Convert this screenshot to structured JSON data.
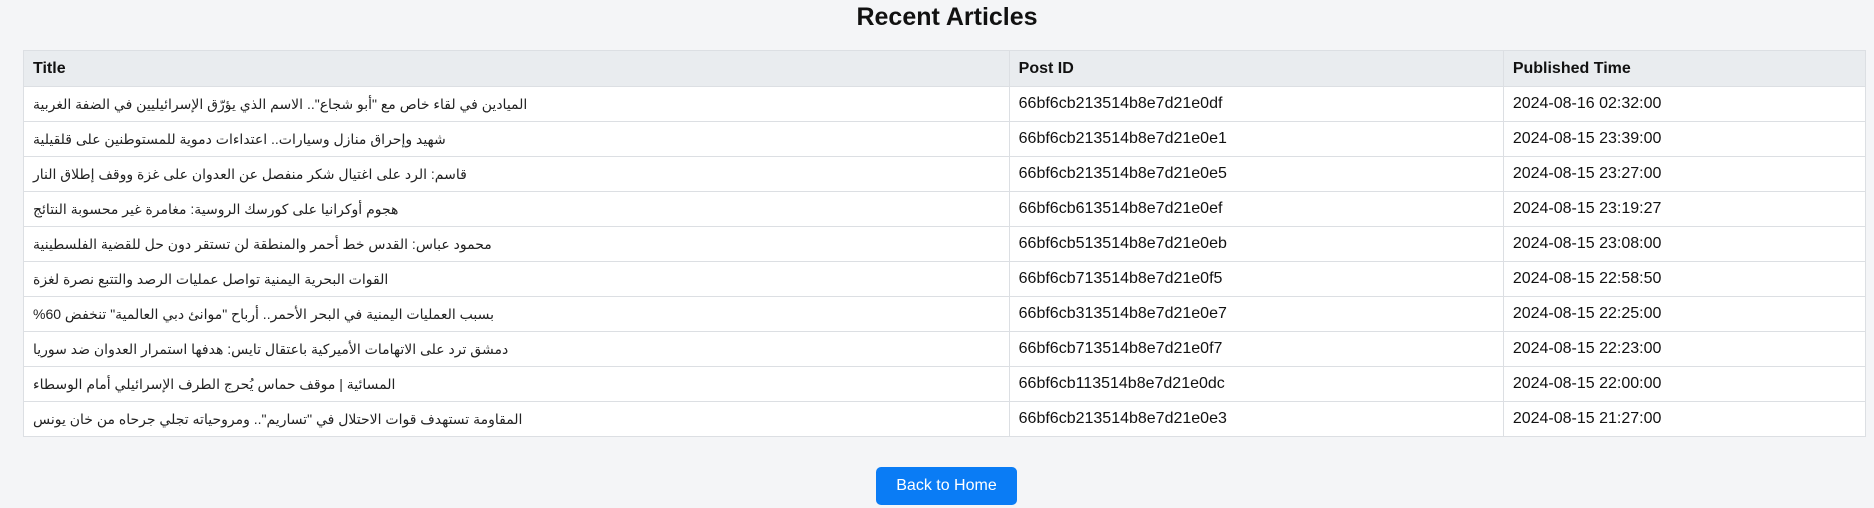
{
  "page": {
    "heading": "Recent Articles",
    "back_button_label": "Back to Home"
  },
  "table": {
    "headers": [
      "Title",
      "Post ID",
      "Published Time"
    ],
    "rows": [
      {
        "title": "الميادين في لقاء خاص مع \"أبو شجاع\".. الاسم الذي يؤرّق الإسرائيليين في الضفة الغربية",
        "post_id": "66bf6cb213514b8e7d21e0df",
        "time": "2024-08-16 02:32:00"
      },
      {
        "title": "شهيد وإحراق منازل وسيارات.. اعتداءات دموية للمستوطنين على قلقيلية",
        "post_id": "66bf6cb213514b8e7d21e0e1",
        "time": "2024-08-15 23:39:00"
      },
      {
        "title": "قاسم: الرد على اغتيال شكر منفصل عن العدوان على غزة ووقف إطلاق النار",
        "post_id": "66bf6cb213514b8e7d21e0e5",
        "time": "2024-08-15 23:27:00"
      },
      {
        "title": "هجوم أوكرانيا على كورسك الروسية: مغامرة غير محسوبة النتائج",
        "post_id": "66bf6cb613514b8e7d21e0ef",
        "time": "2024-08-15 23:19:27"
      },
      {
        "title": "محمود عباس: القدس خط أحمر والمنطقة لن تستقر دون حل للقضية الفلسطينية",
        "post_id": "66bf6cb513514b8e7d21e0eb",
        "time": "2024-08-15 23:08:00"
      },
      {
        "title": "القوات البحرية اليمنية تواصل عمليات الرصد والتتبع نصرة لغزة",
        "post_id": "66bf6cb713514b8e7d21e0f5",
        "time": "2024-08-15 22:58:50"
      },
      {
        "title": "بسبب العمليات اليمنية في البحر الأحمر.. أرباح \"موانئ دبي العالمية\" تنخفض 60%",
        "post_id": "66bf6cb313514b8e7d21e0e7",
        "time": "2024-08-15 22:25:00"
      },
      {
        "title": "دمشق ترد على الاتهامات الأميركية باعتقال تايس: هدفها استمرار العدوان ضد سوريا",
        "post_id": "66bf6cb713514b8e7d21e0f7",
        "time": "2024-08-15 22:23:00"
      },
      {
        "title": "المسائية | موقف حماس يُحرج الطرف الإسرائيلي أمام الوسطاء",
        "post_id": "66bf6cb113514b8e7d21e0dc",
        "time": "2024-08-15 22:00:00"
      },
      {
        "title": "المقاومة تستهدف قوات الاحتلال في \"تساريم\".. ومروحياته تجلي جرحاه من خان يونس",
        "post_id": "66bf6cb213514b8e7d21e0e3",
        "time": "2024-08-15 21:27:00"
      }
    ]
  },
  "colors": {
    "background": "#f4f5f7",
    "header_bg": "#e9ecef",
    "button_bg": "#0a7cf5"
  }
}
